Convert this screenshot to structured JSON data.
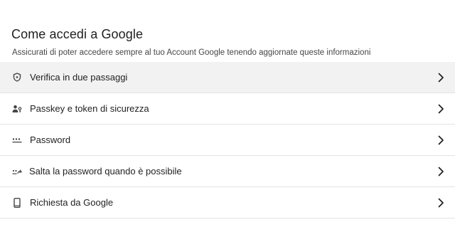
{
  "section": {
    "title": "Come accedi a Google",
    "subtitle": "Assicurati di poter accedere sempre al tuo Account Google tenendo aggiornate queste informazioni"
  },
  "items": [
    {
      "label": "Verifica in due passaggi",
      "icon": "shield-icon",
      "highlighted": true
    },
    {
      "label": "Passkey e token di sicurezza",
      "icon": "person-key-icon",
      "highlighted": false
    },
    {
      "label": "Password",
      "icon": "password-dots-icon",
      "highlighted": false
    },
    {
      "label": "Salta la password quando è possibile",
      "icon": "skip-password-icon",
      "highlighted": false
    },
    {
      "label": "Richiesta da Google",
      "icon": "phone-icon",
      "highlighted": false
    }
  ],
  "colors": {
    "text": "#1f1f1f",
    "secondary_text": "#444746",
    "divider": "#e3e3e3",
    "highlight_bg": "#f2f2f2"
  }
}
